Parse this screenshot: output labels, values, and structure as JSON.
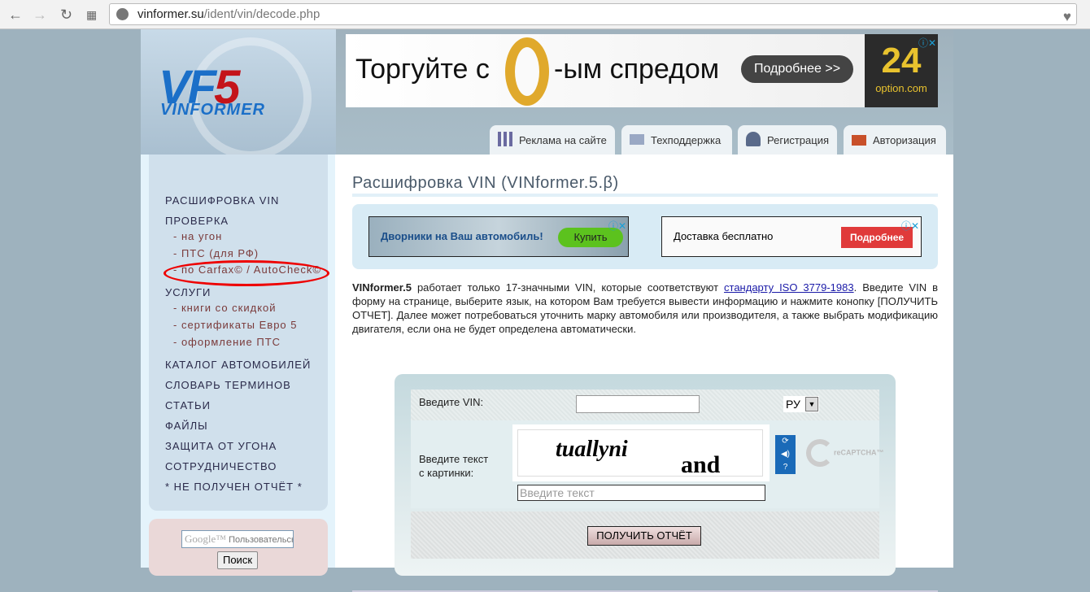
{
  "browser": {
    "url_host": "vinformer.su",
    "url_path": "/ident/vin/decode.php"
  },
  "header": {
    "logo_text": "VF5 VINFORMER",
    "banner": {
      "text_before": "Торгуйте с",
      "text_after": "-ым  спредом",
      "button": "Подробнее >>",
      "brand": "24",
      "brand_domain": "option.com"
    },
    "tabs": [
      {
        "label": "Реклама на сайте",
        "icon": "bar-chart-icon"
      },
      {
        "label": "Техподдержка",
        "icon": "envelope-icon"
      },
      {
        "label": "Регистрация",
        "icon": "user-add-icon"
      },
      {
        "label": "Авторизация",
        "icon": "lock-icon"
      }
    ]
  },
  "sidebar": {
    "items": [
      {
        "label": "РАСШИФРОВКА VIN",
        "sub": false
      },
      {
        "label": "ПРОВЕРКА",
        "sub": false
      },
      {
        "label": "- на угон",
        "sub": true
      },
      {
        "label": "- ПТС (для РФ)",
        "sub": true
      },
      {
        "label": "- по Carfax© / AutoCheck©",
        "sub": true
      },
      {
        "label": "УСЛУГИ",
        "sub": false
      },
      {
        "label": "- книги со скидкой",
        "sub": true
      },
      {
        "label": "- сертификаты Евро 5",
        "sub": true
      },
      {
        "label": "- оформление ПТС",
        "sub": true
      },
      {
        "label": "КАТАЛОГ АВТОМОБИЛЕЙ",
        "sub": false
      },
      {
        "label": "СЛОВАРЬ ТЕРМИНОВ",
        "sub": false
      },
      {
        "label": "СТАТЬИ",
        "sub": false
      },
      {
        "label": "ФАЙЛЫ",
        "sub": false
      },
      {
        "label": "ЗАЩИТА ОТ УГОНА",
        "sub": false
      },
      {
        "label": "СОТРУДНИЧЕСТВО",
        "sub": false
      },
      {
        "label": "* НЕ ПОЛУЧЕН ОТЧЁТ *",
        "sub": false
      }
    ],
    "search": {
      "google": "Google™",
      "placeholder": "Пользовательски",
      "button": "Поиск"
    }
  },
  "main": {
    "title": "Расшифровка VIN (VINformer.5.β)",
    "ads": [
      {
        "text": "Дворники на Ваш автомобиль!",
        "button": "Купить"
      },
      {
        "text": "Доставка бесплатно",
        "button": "Подробнее"
      }
    ],
    "intro": {
      "brand": "VINformer.5",
      "p1": " работает только 17-значными VIN, которые соответствуют ",
      "link": "стандарту ISO 3779-1983",
      "p2": ". Введите VIN в форму на странице, выберите язык, на котором Вам требуется вывести информацию и нажмите конопку [ПОЛУЧИТЬ ОТЧЕТ]. Далее может потребоваться уточнить марку автомобиля или производителя, а также выбрать модификацию двигателя, если она не будет определена автоматически."
    },
    "form": {
      "vin_label": "Введите VIN:",
      "vin_value": "",
      "lang": "РУ",
      "captcha_label_1": "Введите текст",
      "captcha_label_2": "с картинки:",
      "captcha_word1": "tuallyni",
      "captcha_word2": "and",
      "captcha_placeholder": "Введите текст",
      "recaptcha": "reCAPTCHA™",
      "submit": "ПОЛУЧИТЬ ОТЧЁТ"
    }
  }
}
